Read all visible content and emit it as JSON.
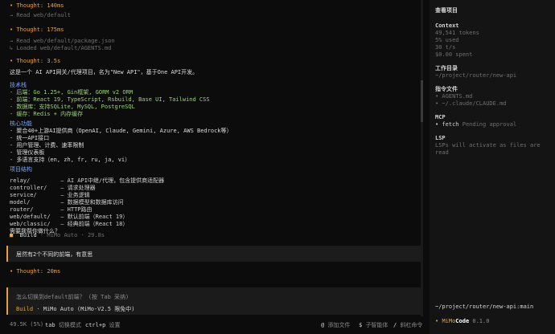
{
  "transcript": {
    "thought1": "• Thought: 140ms",
    "read1": "→ Read web/default",
    "thought2": "• Thought: 175ms",
    "read2": "→ Read web/default/package.json",
    "loaded": "↳ Loaded web/default/AGENTS.md",
    "thought3": "• Thought: 3.5s",
    "intro": "这是一个 AI API网关/代理项目，名为\"New API\"，基于One API开发。",
    "tech_title": "技术栈",
    "tech": [
      "- 后端：Go 1.25+, Gin框架, GORM v2 ORM",
      "- 前端：React 19, TypeScript, Rsbuild, Base UI, Tailwind CSS",
      "- 数据库：支持SQLite, MySQL, PostgreSQL",
      "- 缓存：Redis + 内存缓存"
    ],
    "features_title": "核心功能",
    "features": [
      "- 聚合40+上游AI提供商（OpenAI, Claude, Gemini, Azure, AWS Bedrock等）",
      "- 统一API接口",
      "- 用户管理、计费、速率限制",
      "- 管理仪表板",
      "- 多语言支持（en, zh, fr, ru, ja, vi）"
    ],
    "structure_title": "项目结构",
    "structure": [
      "relay/         — AI API中继/代理，包含提供商适配器",
      "controller/    — 请求处理器",
      "service/       — 业务逻辑",
      "model/         — 数据模型和数据库访问",
      "router/        — HTTP路由",
      "web/default/   — 默认前端（React 19）",
      "web/classic/   — 经典前端（React 18）"
    ],
    "question": "需要我帮你做什么？",
    "build_mark": "■",
    "build_label": "Build",
    "build_meta": "· MiMo Auto · 29.8s",
    "user_message": "居然有2个不同的前端，有意思",
    "thought4": "• Thought: 20ms"
  },
  "input": {
    "placeholder": "怎么切换到default前端？  (按 Tab 采纳)",
    "mode": "Build",
    "model": "· MiMo Auto (MiMo-V2.5 限免中)"
  },
  "statusbar": {
    "tokens": "49.5K (5%)",
    "tab_key": "tab",
    "tab_label": "切换模式",
    "ctrlp_key": "ctrl+p",
    "ctrlp_label": "设置",
    "at_key": "@",
    "at_label": "添加文件",
    "dollar_key": "$",
    "dollar_label": "子智能体",
    "slash_key": "/",
    "slash_label": "斜杠命令"
  },
  "sidebar": {
    "title": "查看项目",
    "context_head": "Context",
    "context_tokens": "49,541 tokens",
    "context_used": "5% used",
    "context_speed": "30 t/s",
    "context_spent": "$0.00 spent",
    "workdir_head": "工作目录",
    "workdir": "~/project/router/new-api",
    "instr_head": "指令文件",
    "instr_files": [
      "• AGENTS.md",
      "• ~/.claude/CLAUDE.md"
    ],
    "mcp_head": "MCP",
    "mcp_name": "• fetch",
    "mcp_status": "Pending approval",
    "lsp_head": "LSP",
    "lsp_text": "LSPs will activate as files are read",
    "path_branch": "~/project/router/new-api:main",
    "brand_mark": "•",
    "brand_a": "MiMo",
    "brand_b": "Code",
    "version": "0.1.0"
  },
  "colors": {
    "accent": "#e8a13a",
    "blue": "#7aa2f7",
    "background": "#0c0c0c",
    "panel": "#141414"
  }
}
